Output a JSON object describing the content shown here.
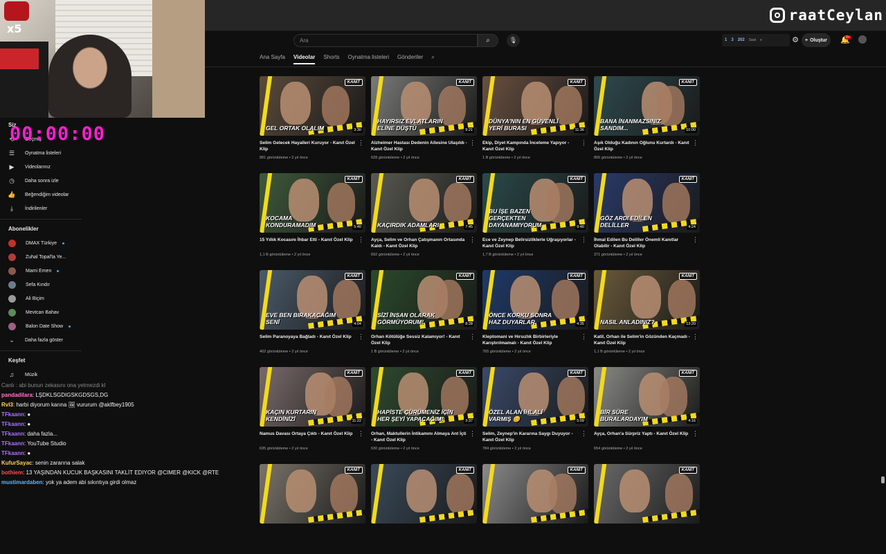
{
  "overlay": {
    "instagram_handle": "raatCeylan",
    "timer": "00:00:00",
    "webcam_badge": "x5"
  },
  "search": {
    "placeholder": "Ara"
  },
  "header": {
    "stats": [
      "1",
      "3",
      "202",
      "Saat"
    ],
    "create_label": "Oluştur",
    "notif_count": "9+"
  },
  "tabs": [
    {
      "label": "Ana Sayfa",
      "active": false
    },
    {
      "label": "Videolar",
      "active": true
    },
    {
      "label": "Shorts",
      "active": false
    },
    {
      "label": "Oynatma listeleri",
      "active": false
    },
    {
      "label": "Gönderiler",
      "active": false
    }
  ],
  "sidebar": {
    "you_label": "Siz",
    "items": [
      {
        "label": "Geçmiş",
        "icon": "history-icon",
        "glyph": "⟲"
      },
      {
        "label": "Oynatma listeleri",
        "icon": "playlist-icon",
        "glyph": "☰"
      },
      {
        "label": "Videolarınız",
        "icon": "video-icon",
        "glyph": "▶"
      },
      {
        "label": "Daha sonra izle",
        "icon": "clock-icon",
        "glyph": "◷"
      },
      {
        "label": "Beğendiğim videolar",
        "icon": "thumbs-up-icon",
        "glyph": "👍"
      },
      {
        "label": "İndirilenler",
        "icon": "download-icon",
        "glyph": "⤓"
      }
    ],
    "subs_title": "Abonelikler",
    "subscriptions": [
      {
        "label": "DMAX Türkiye",
        "color": "#c4302b",
        "live": true
      },
      {
        "label": "Zuhal Topal'la Ye...",
        "color": "#b33b3b",
        "live": false
      },
      {
        "label": "Mami Emen",
        "color": "#8a5a4a",
        "live": true
      },
      {
        "label": "Sefa Kındır",
        "color": "#6b7d8c",
        "live": false
      },
      {
        "label": "Ali Biçim",
        "color": "#9a9a9a",
        "live": false
      },
      {
        "label": "Mevtcan Bahav",
        "color": "#5b8b5b",
        "live": false
      },
      {
        "label": "Balon Date Show",
        "color": "#a06080",
        "live": true
      }
    ],
    "show_more": "Daha fazla göster",
    "explore_title": "Keşfet",
    "explore_items": [
      {
        "label": "Müzik",
        "icon": "music-icon",
        "glyph": "♫"
      }
    ]
  },
  "chat": [
    {
      "user": "",
      "text": "Canlı : abi bunun zekasını ona yetmezdi kl",
      "color": "#888"
    },
    {
      "user": "pandadilara",
      "text": ": LŞDKLSGDIGSKGDSGS,DG",
      "color": "#ff7acd"
    },
    {
      "user": "Rvl3",
      "text": ": harbi diyorum karına 🖼 vururum @aklfbey1905",
      "color": "#ffd15c"
    },
    {
      "user": "TFkaann",
      "text": ": ●",
      "color": "#a970ff"
    },
    {
      "user": "TFkaann",
      "text": ": ●",
      "color": "#a970ff"
    },
    {
      "user": "TFkaann",
      "text": ": daha fazla...",
      "color": "#a970ff"
    },
    {
      "user": "TFkaann",
      "text": ": YouTube Studio",
      "color": "#a970ff"
    },
    {
      "user": "TFkaann",
      "text": ": ●",
      "color": "#a970ff"
    },
    {
      "user": "KufurSayac",
      "text": ": senin zararına salak",
      "color": "#ffd15c"
    },
    {
      "user": "bothiem",
      "text": ": 13 YAŞINDAN KUCUK BAŞKASINI TAKLİT EDIYOR @CIMER @KICK @RTE",
      "color": "#ff4f4f"
    },
    {
      "user": "mustimardaben",
      "text": ": yok ya adem abi sıkıntıya girdi olmaz",
      "color": "#5cb8ff"
    }
  ],
  "videos": [
    {
      "caption": "GEL ORTAK OLALIM",
      "duration": "3:30",
      "title": "Selim Gelecek Hayalleri Kuruyor - Kanıt Özel Klip",
      "meta": "881 görüntüleme • 2 yıl önce",
      "bg": "#5a4a3a"
    },
    {
      "caption": "HAYIRSIZ EVLATLARIN ELİNE DÜŞTÜ",
      "duration": "9:21",
      "title": "Alzheimer Hastası Dedenin Ailesine Ulaşıldı - Kanıt Özel Klip",
      "meta": "628 görüntüleme • 2 yıl önce",
      "bg": "#7a7a78"
    },
    {
      "caption": "DÜNYA'NIN EN GÜVENLİ YERİ BURASI",
      "duration": "11:36",
      "title": "Ekip, Diyet Kampında İnceleme Yapıyor - Kanıt Özel Klip",
      "meta": "1 B görüntüleme • 2 yıl önce",
      "bg": "#6a5040"
    },
    {
      "caption": "BANA İNANMAZSINIZ SANDIM...",
      "duration": "10:00",
      "title": "Aşık Olduğu Kadının Oğlunu Kurtardı - Kanıt Özel Klip",
      "meta": "805 görüntüleme • 2 yıl önce",
      "bg": "#2e4a4e"
    },
    {
      "caption": "KOCAMA KONDURAMADIM",
      "duration": "5:40",
      "title": "15 Yıllık Kocasını İhbar Etti - Kanıt Özel Klip",
      "meta": "1,1 B görüntüleme • 2 yıl önce",
      "bg": "#3e5a3a"
    },
    {
      "caption": "KAÇIRDIK ADAMLARI",
      "duration": "7:45",
      "title": "Ayça, Selim ve Orhan Çatışmanın Ortasında Kaldı - Kanıt Özel Klip",
      "meta": "692 görüntüleme • 2 yıl önce",
      "bg": "#5a5a52"
    },
    {
      "caption": "BU İŞE BAZEN GERÇEKTEN DAYANAMIYORUM",
      "duration": "9:40",
      "title": "Ece ve Zeynep Belirsizliklerle Uğraşıyorlar - Kanıt Özel Klip",
      "meta": "1,7 B görüntüleme • 2 yıl önce",
      "bg": "#2a4a4a"
    },
    {
      "caption": "GÖZ ARDI EDİLEN DELİLLER",
      "duration": "4:24",
      "title": "İhmal Edilen Bu Deliller Önemli Kanıtlar Olabilir - Kanıt Özel Klip",
      "meta": "371 görüntüleme • 2 yıl önce",
      "bg": "#2a3a6a"
    },
    {
      "caption": "EVE BEN BIRAKACAĞIM SENİ",
      "duration": "4:04",
      "title": "Selim Paranoyaya Bağladı - Kanıt Özel Klip",
      "meta": "402 görüntüleme • 2 yıl önce",
      "bg": "#4a5a6a"
    },
    {
      "caption": "SİZİ İNSAN OLARAK GÖRMÜYORUM!",
      "duration": "8:28",
      "title": "Orhan Kötülüğe Sessiz Kalamıyor! - Kanıt Özel Klip",
      "meta": "1 B görüntüleme • 2 yıl önce",
      "bg": "#2a4a2a"
    },
    {
      "caption": "ÖNCE KORKU SONRA HAZ DUYARLAR",
      "duration": "4:35",
      "title": "Kleptomani ve Hırsızlık Birbirleriyle Karıştırılmamalı - Kanıt Özel Klip",
      "meta": "765 görüntüleme • 2 yıl önce",
      "bg": "#1e3a6a"
    },
    {
      "caption": "NASIL ANLADINIZ?",
      "duration": "13:20",
      "title": "Katil, Orhan ile Selim'in Gözünden Kaçmadı - Kanıt Özel Klip",
      "meta": "1,1 B görüntüleme • 2 yıl önce",
      "bg": "#6a5a3a"
    },
    {
      "caption": "KAÇIN KURTARIN KENDİNİZİ",
      "duration": "11:22",
      "title": "Namus Davası Ortaya Çıktı - Kanıt Özel Klip",
      "meta": "635 görüntüleme • 2 yıl önce",
      "bg": "#7a6a6a"
    },
    {
      "caption": "HAPİSTE ÇÜRÜMENİZ İÇİN HER ŞEYİ YAPACAĞIM!",
      "duration": "3:37",
      "title": "Orhan, Maktullerin İntikamını Almaya Ant İçti - Kanıt Özel Klip",
      "meta": "630 görüntüleme • 2 yıl önce",
      "bg": "#2e4a2e"
    },
    {
      "caption": "ÖZEL ALAN İHLALİ VARMIŞ 😊",
      "duration": "5:09",
      "title": "Selim, Zeynep'in Kararına Saygı Duyuyor - Kanıt Özel Klip",
      "meta": "784 görüntüleme • 2 yıl önce",
      "bg": "#3a4a6a"
    },
    {
      "caption": "BİR SÜRE BURALARDAYIM",
      "duration": "4:16",
      "title": "Ayça, Orhan'a Sürpriz Yaptı - Kanıt Özel Klip",
      "meta": "654 görüntüleme • 2 yıl önce",
      "bg": "#8a8a86"
    },
    {
      "caption": "",
      "duration": "",
      "title": "",
      "meta": "",
      "bg": "#7a746a"
    },
    {
      "caption": "",
      "duration": "",
      "title": "",
      "meta": "",
      "bg": "#3a4a5a"
    },
    {
      "caption": "",
      "duration": "",
      "title": "",
      "meta": "",
      "bg": "#8a8a8a"
    },
    {
      "caption": "",
      "duration": "",
      "title": "",
      "meta": "",
      "bg": "#6a6a6a"
    }
  ],
  "badge_text": "KANIT",
  "colors": {
    "accent": "#f3d91d",
    "timer": "#ff1ed2",
    "background": "#0f0f0f"
  }
}
